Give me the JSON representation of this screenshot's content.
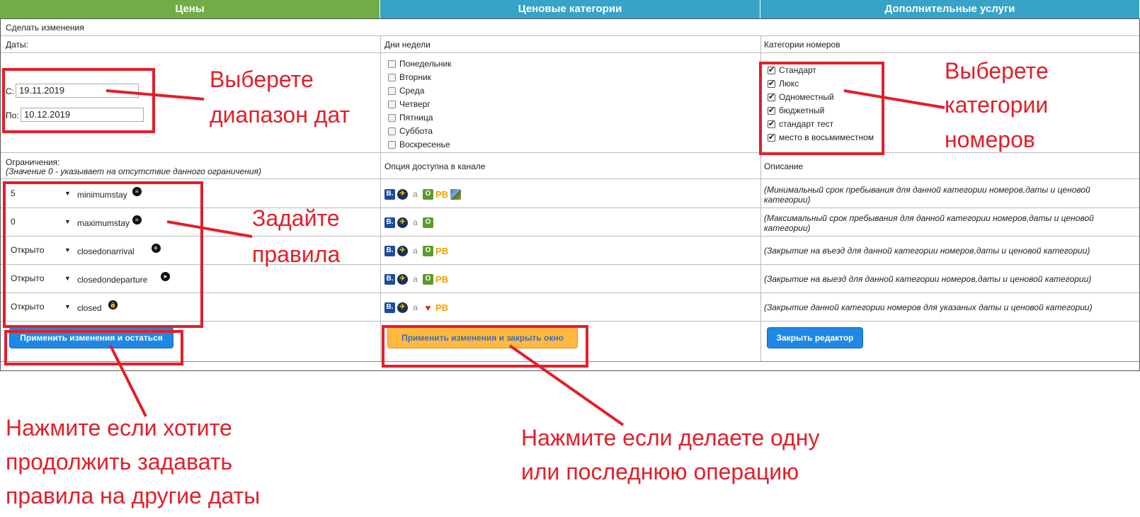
{
  "tabs": [
    "Цены",
    "Ценовые категории",
    "Дополнительные услуги"
  ],
  "toolbar_label": "Сделать изменения",
  "dates": {
    "header": "Даты:",
    "from_label": "С:",
    "from_value": "19.11.2019",
    "to_label": "По:",
    "to_value": "10.12.2019"
  },
  "weekdays": {
    "header": "Дни недели",
    "items": [
      "Понедельник",
      "Вторник",
      "Среда",
      "Четверг",
      "Пятница",
      "Суббота",
      "Воскресенье"
    ]
  },
  "rooms": {
    "header": "Категории номеров",
    "items": [
      "Стандарт",
      "Люкс",
      "Одноместный",
      "бюджетный",
      "стандарт тест",
      "место в восьмиместном"
    ]
  },
  "restrictions": {
    "header": "Ограничения:",
    "subheader": "(Значение 0 - указывает на отсутствие данного ограничения)",
    "channel_header": "Опция доступна в канале",
    "description_header": "Описание",
    "rows": [
      {
        "value": "5",
        "name": "minimumstay",
        "icon": "list-icon",
        "desc": "(Минимальный срок пребывания для данной категории номеров,даты и ценовой",
        "desc2": "категории)"
      },
      {
        "value": "0",
        "name": "maximumstay",
        "icon": "list-icon",
        "desc": "(Максимальный срок пребывания для данной категории номеров,даты и ценовой",
        "desc2": "категории)"
      },
      {
        "value": "Открыто",
        "name": "closedonarrival",
        "icon": "plane-arrive-icon",
        "desc": "(Закрытие на въезд для данной категории номеров,даты и ценовой категории)",
        "desc2": ""
      },
      {
        "value": "Открыто",
        "name": "closedondeparture",
        "icon": "plane-depart-icon",
        "desc": "(Закрытие на выезд для данной категории номеров,даты и ценовой категории)",
        "desc2": ""
      },
      {
        "value": "Открыто",
        "name": "closed",
        "icon": "lock-icon",
        "desc": "(Закрытие данной категории номеров для указаных даты и ценовой категории)",
        "desc2": ""
      }
    ]
  },
  "channel_icons": {
    "b": "B.",
    "a": "a",
    "o": "O",
    "p": "PB"
  },
  "buttons": {
    "apply_stay": "Применить изменения и остаться",
    "apply_close": "Применить изменения и закрыть окно",
    "close_editor": "Закрыть редактор"
  },
  "annotations": {
    "dates_1": "Выберете",
    "dates_2": "диапазон дат",
    "rooms_1": "Выберете",
    "rooms_2": "категории",
    "rooms_3": "номеров",
    "rules_1": "Задайте",
    "rules_2": "правила",
    "stay_1": "Нажмите если хотите",
    "stay_2": "продолжить задавать",
    "stay_3": "правила на другие даты",
    "close_1": "Нажмите если делаете одну",
    "close_2": "или последнюю операцию"
  },
  "colors": {
    "price_tab": "#70ad47",
    "tab": "#36a3c7",
    "annotation": "#e21f2a",
    "button_blue": "#1e88e5",
    "button_orange": "#ffb93f"
  }
}
